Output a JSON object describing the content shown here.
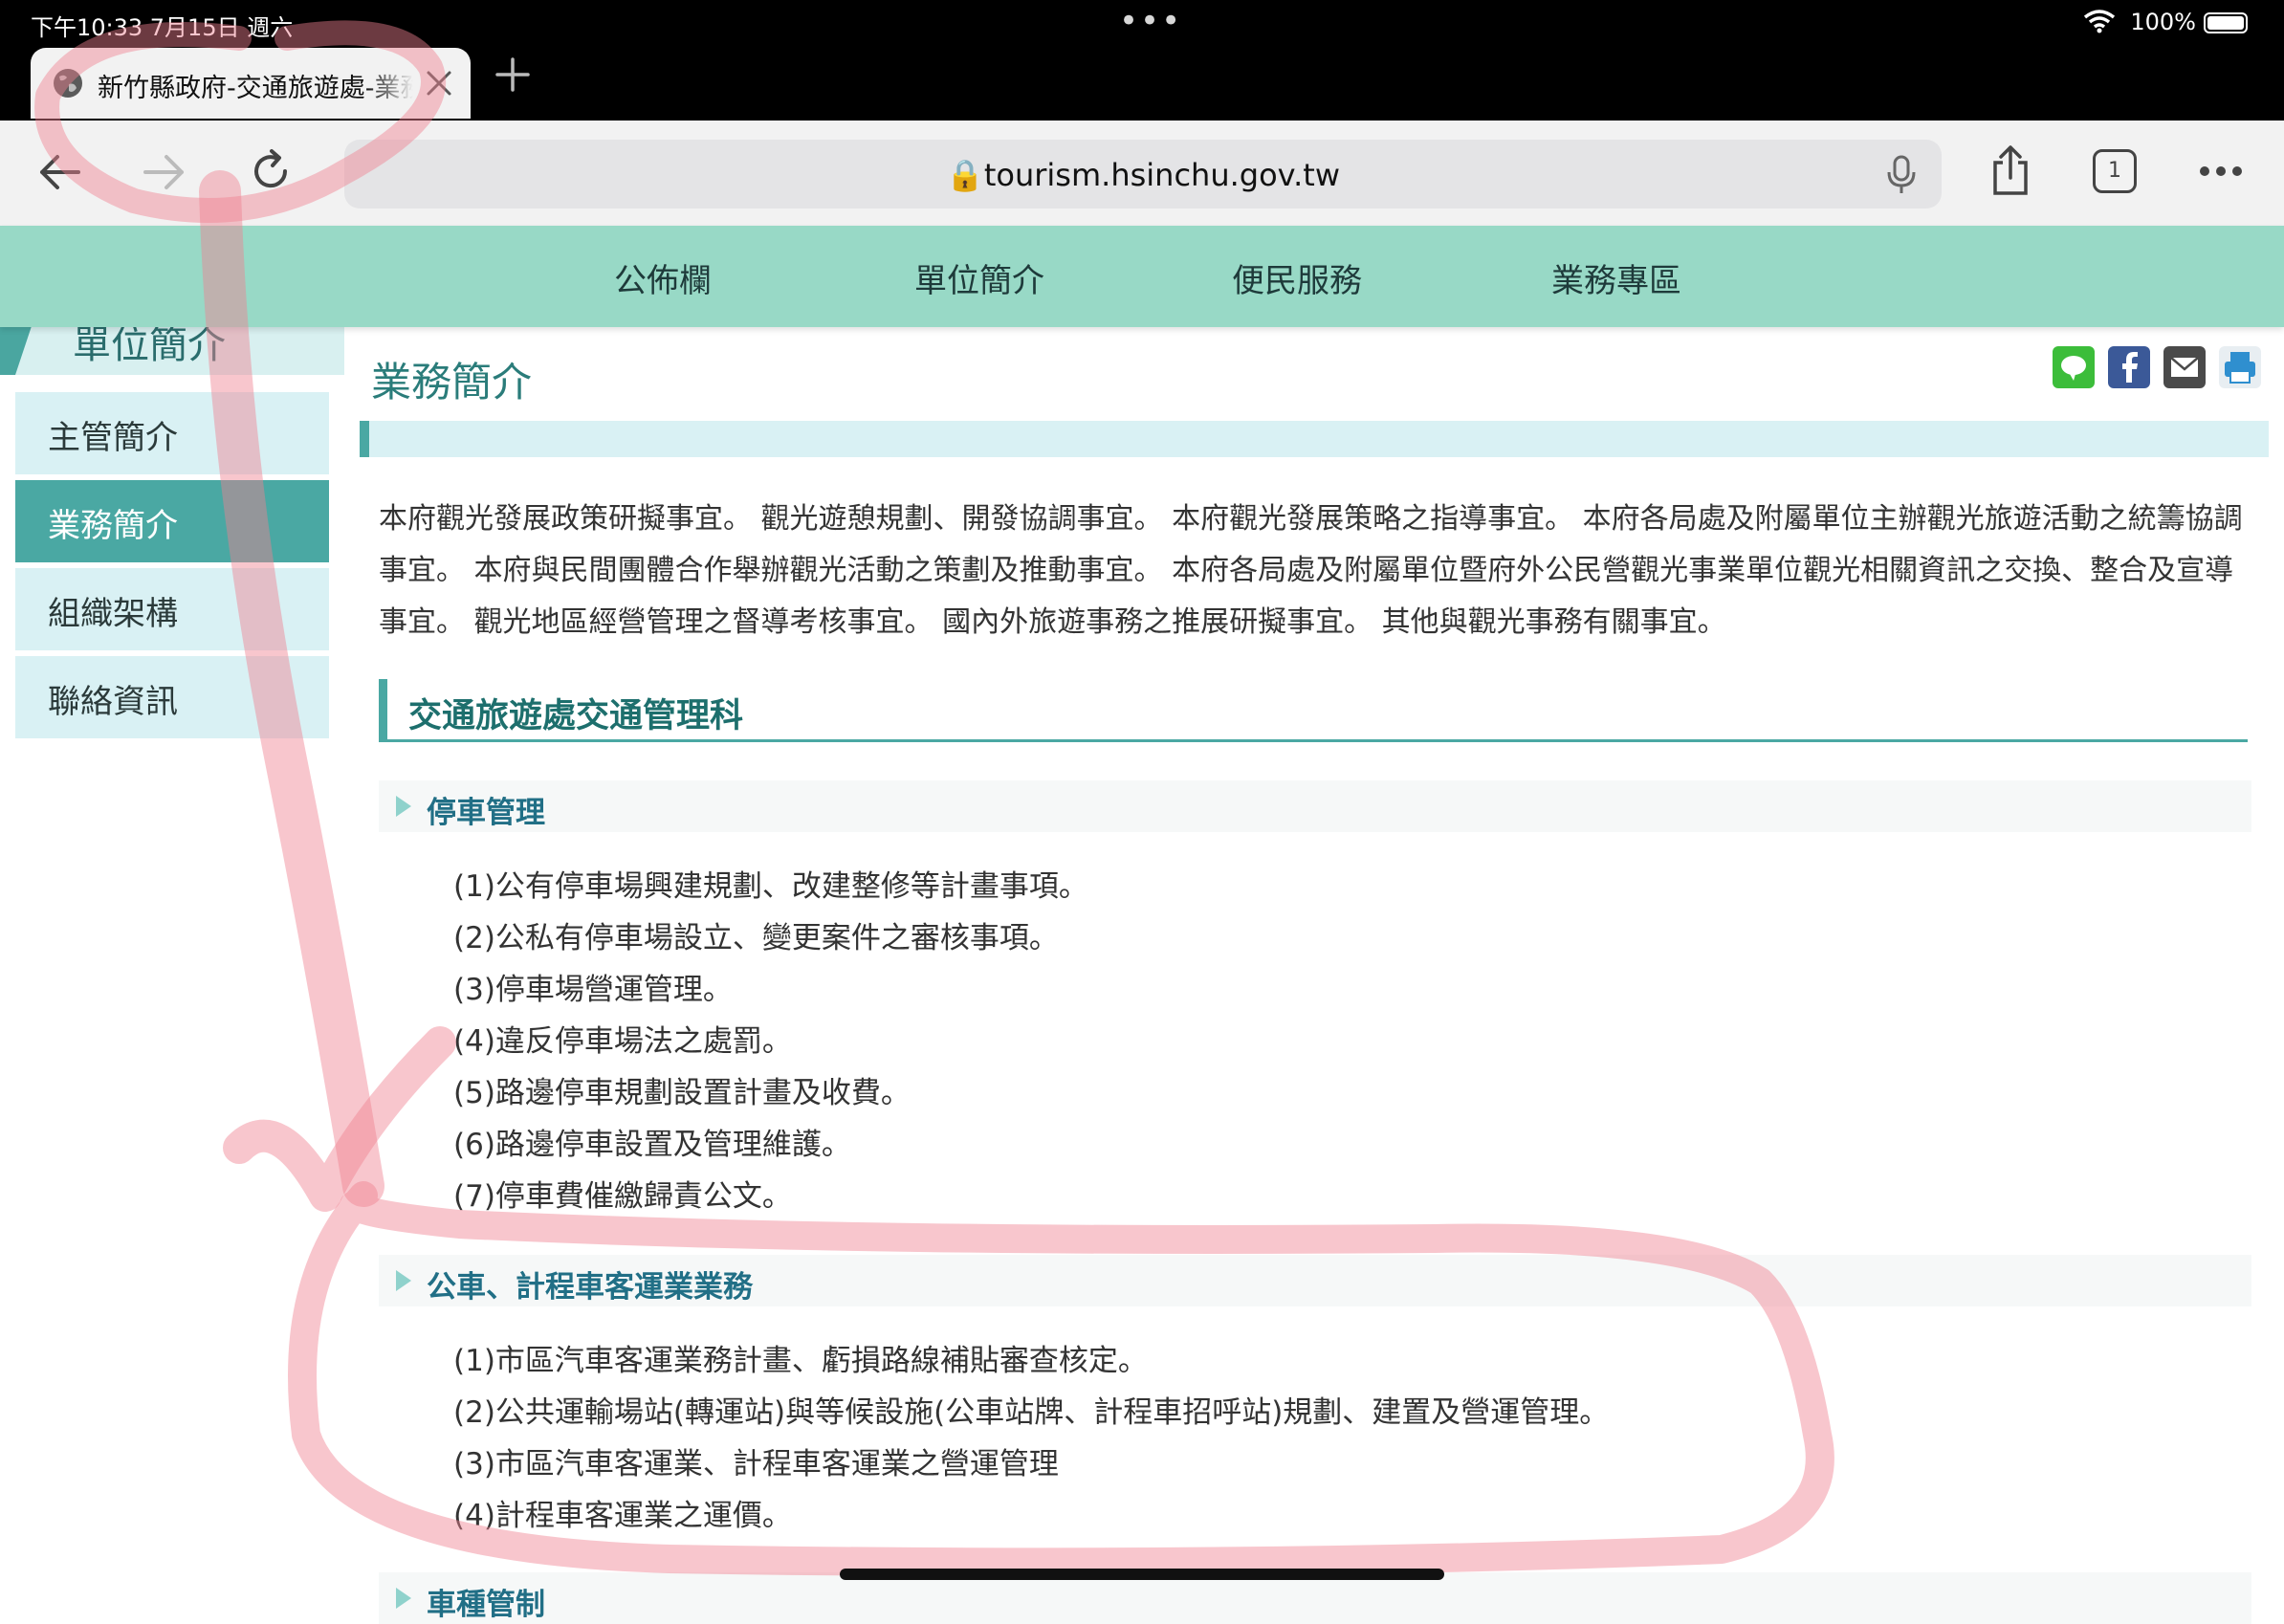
{
  "status_bar": {
    "time": "下午10:33   7月15日 週六",
    "battery_pct": "100%"
  },
  "tab": {
    "title": "新竹縣政府-交通旅遊處-業務簡介",
    "globe_icon": "globe-icon",
    "close_icon": "close-icon",
    "new_tab_icon": "plus-icon"
  },
  "toolbar": {
    "url": "🔒tourism.hsinchu.gov.tw",
    "tab_count": "1",
    "icons": [
      "back-icon",
      "forward-icon",
      "reload-icon",
      "mic-icon",
      "share-icon",
      "tabs-icon",
      "more-icon"
    ]
  },
  "site_nav": {
    "items": [
      "公佈欄",
      "單位簡介",
      "便民服務",
      "業務專區"
    ]
  },
  "sidebar": {
    "heading": "單位簡介",
    "items": [
      "主管簡介",
      "業務簡介",
      "組織架構",
      "聯絡資訊"
    ],
    "active": "業務簡介"
  },
  "content": {
    "title": "業務簡介",
    "intro": "本府觀光發展政策研擬事宜。 觀光遊憩規劃、開發協調事宜。 本府觀光發展策略之指導事宜。 本府各局處及附屬單位主辦觀光旅遊活動之統籌協調事宜。 本府與民間團體合作舉辦觀光活動之策劃及推動事宜。 本府各局處及附屬單位暨府外公民營觀光事業單位觀光相關資訊之交換、整合及宣導事宜。 觀光地區經營管理之督導考核事宜。 國內外旅遊事務之推展研擬事宜。 其他與觀光事務有關事宜。",
    "section_heading": "交通旅遊處交通管理科",
    "subsections": [
      {
        "title": "停車管理",
        "items": [
          "(1)公有停車場興建規劃、改建整修等計畫事項。",
          "(2)公私有停車場設立、變更案件之審核事項。",
          "(3)停車場營運管理。",
          "(4)違反停車場法之處罰。",
          "(5)路邊停車規劃設置計畫及收費。",
          "(6)路邊停車設置及管理維護。",
          "(7)停車費催繳歸責公文。"
        ]
      },
      {
        "title": "公車、計程車客運業業務",
        "items": [
          "(1)市區汽車客運業務計畫、虧損路線補貼審查核定。",
          "(2)公共運輸場站(轉運站)與等候設施(公車站牌、計程車招呼站)規劃、建置及營運管理。",
          "(3)市區汽車客運業、計程車客運業之營運管理",
          "(4)計程車客運業之運價。"
        ]
      },
      {
        "title": "車種管制",
        "items": []
      }
    ],
    "share_icons": [
      "line-icon",
      "facebook-icon",
      "email-icon",
      "print-icon"
    ]
  },
  "colors": {
    "nav_bg": "#98d9c6",
    "accent": "#4aa8a3",
    "annotation": "#f08090"
  }
}
